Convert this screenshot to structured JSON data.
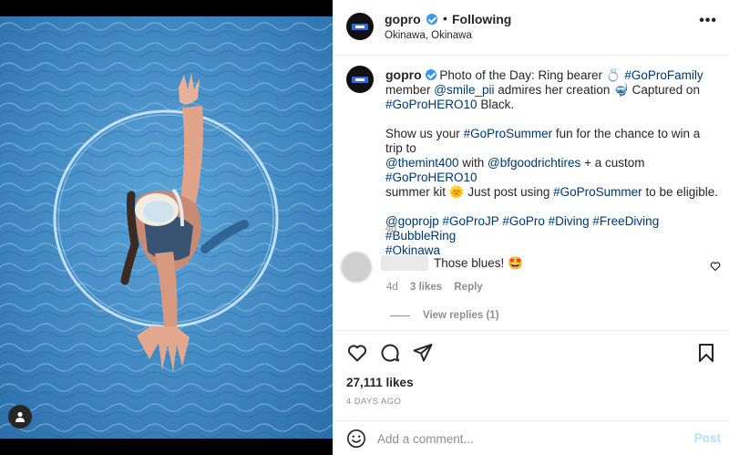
{
  "post": {
    "username": "gopro",
    "follow_dot": "•",
    "follow_label": "Following",
    "location": "Okinawa, Okinawa",
    "more_label": "•••"
  },
  "caption": {
    "username": "gopro",
    "line1_pre": "Photo of the Day: Ring bearer 💍",
    "tag_family": "#GoProFamily",
    "line2_pre": "member",
    "mention_smile": "@smile_pii",
    "line2_post": "admires her creation 🤿 Captured on",
    "tag_hero10_black": "#GoProHERO10",
    "line3_post": "Black.",
    "p2_pre": "Show us your",
    "tag_summer": "#GoProSummer",
    "p2_mid1": "fun for the chance to win a trip to",
    "mention_themint": "@themint400",
    "p2_mid2": "with",
    "mention_bfg": "@bfgoodrichtires",
    "p2_mid3": "+ a custom",
    "tag_hero10": "#GoProHERO10",
    "p2_mid4": "summer kit 🌞 Just post using",
    "tag_summer2": "#GoProSummer",
    "p2_end": "to be eligible.",
    "tags_line": [
      "@goprojp",
      "#GoProJP",
      "#GoPro",
      "#Diving",
      "#FreeDiving",
      "#BubbleRing",
      "#Okinawa"
    ],
    "age": "4d"
  },
  "comment": {
    "text": "Those blues! 🤩",
    "age": "4d",
    "likes": "3 likes",
    "reply": "Reply",
    "view_replies": "View replies (1)"
  },
  "actions": {
    "likes_count": "27,111 likes",
    "date": "4 DAYS AGO"
  },
  "add_comment": {
    "placeholder": "Add a comment...",
    "post_label": "Post"
  },
  "icons": {
    "like": "heart-icon",
    "comment": "comment-bubble-icon",
    "share": "paper-plane-icon",
    "save": "bookmark-icon",
    "emoji": "smiley-icon",
    "tag": "user-tag-icon",
    "more": "more-options-icon"
  },
  "colors": {
    "link": "#00376b",
    "verified": "#3897f0",
    "muted": "#8e8e8e",
    "post_disabled": "#b2dffc",
    "water": "#3d87c2"
  }
}
